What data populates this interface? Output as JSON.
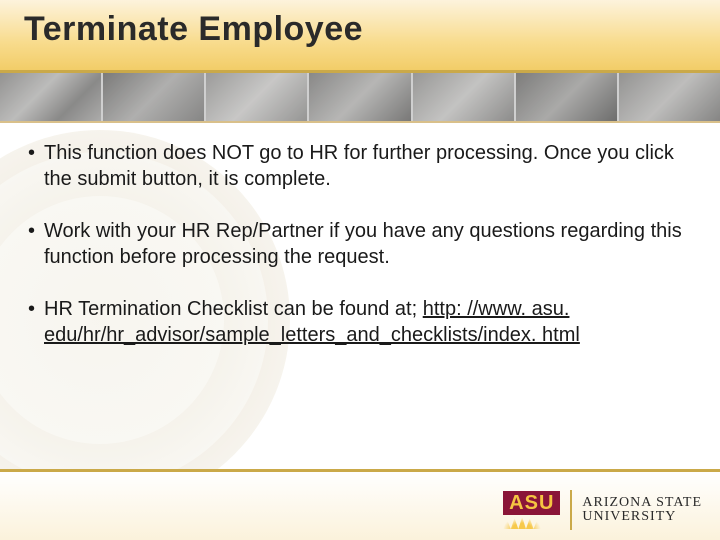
{
  "title": "Terminate Employee",
  "bullets": [
    "This function does NOT go to HR for further processing. Once you click the submit button, it is complete.",
    "Work with your HR Rep/Partner if you have any questions regarding this function before processing the request.",
    "HR Termination Checklist can be found at; "
  ],
  "link_text": "http: //www. asu. edu/hr/hr_advisor/sample_letters_and_checklists/index. html",
  "logo": {
    "mark": "ASU",
    "line1": "ARIZONA STATE",
    "line2": "UNIVERSITY"
  }
}
